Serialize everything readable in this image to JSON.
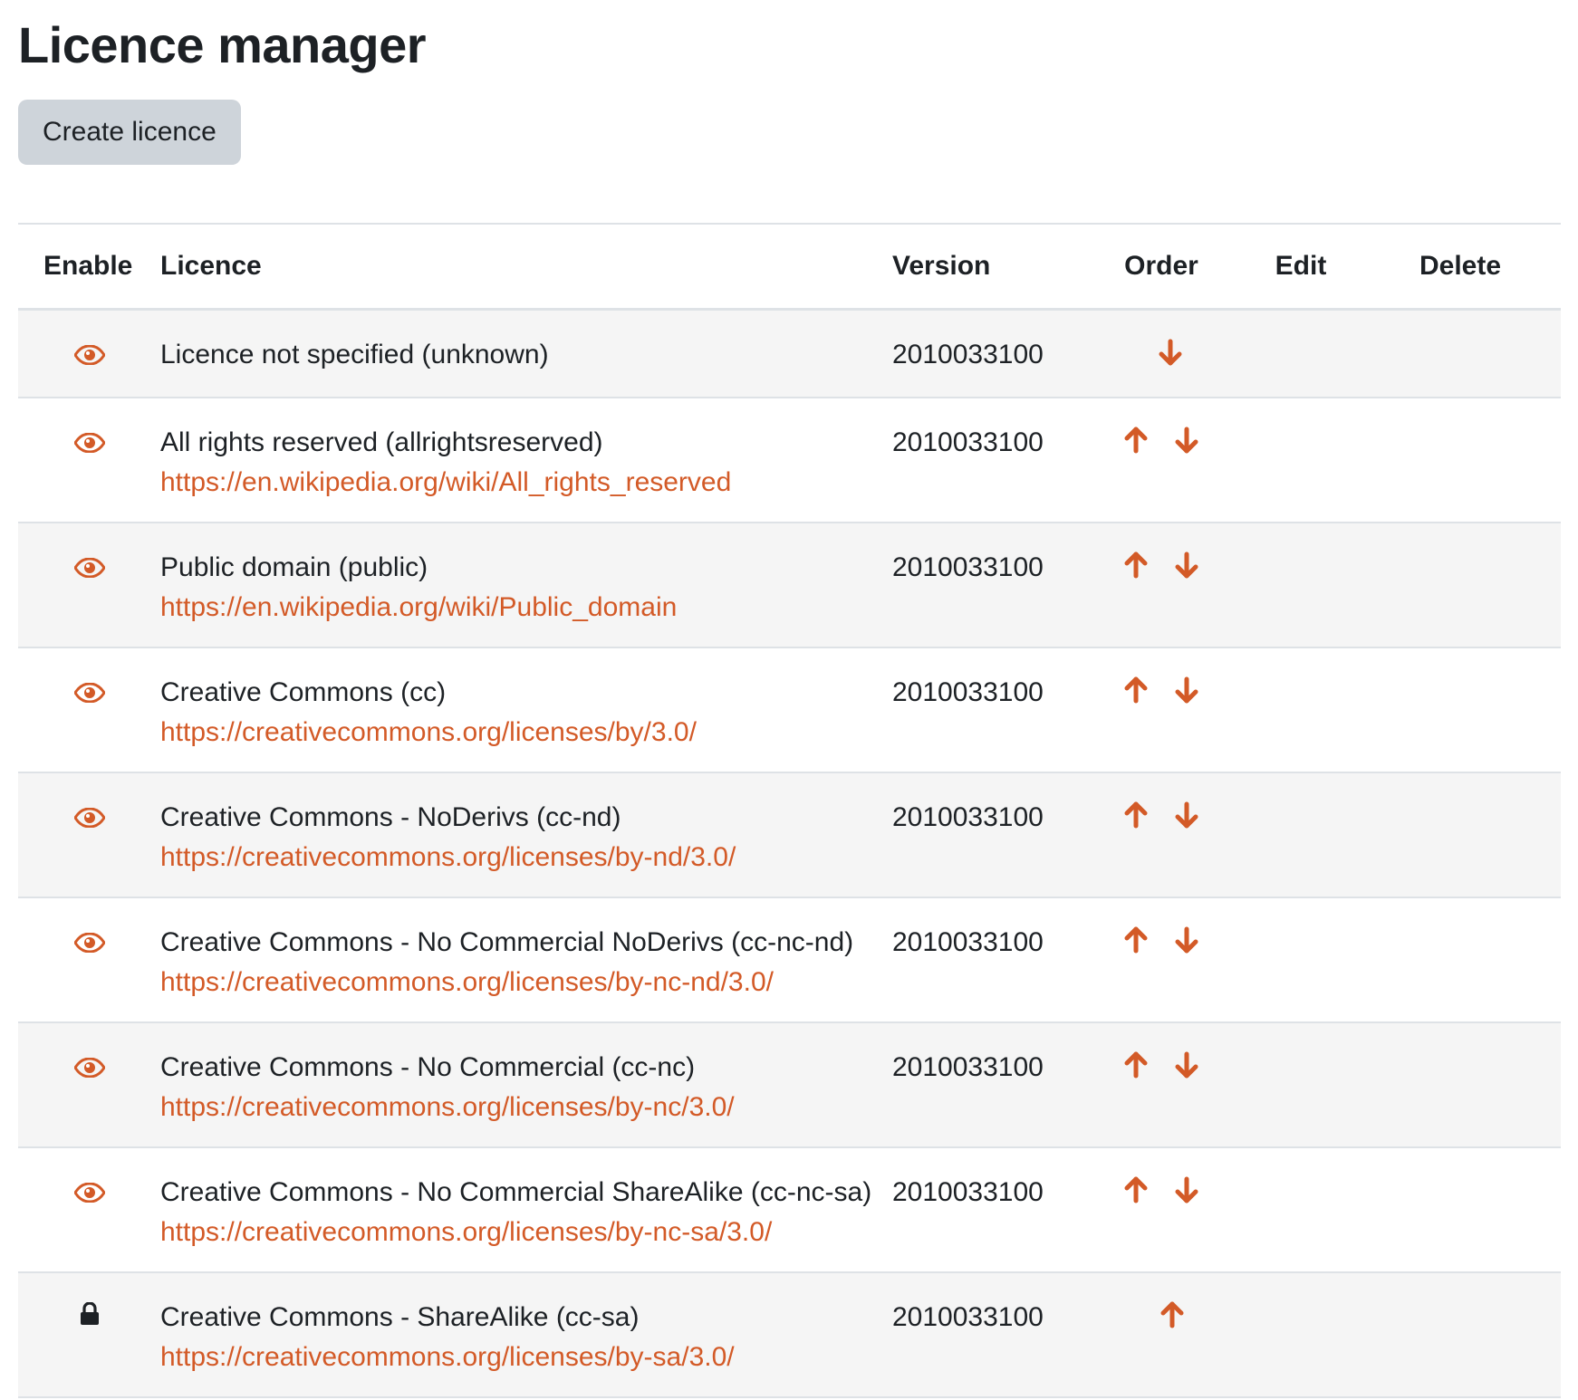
{
  "page": {
    "title": "Licence manager",
    "create_button": "Create licence"
  },
  "table": {
    "headers": {
      "enable": "Enable",
      "licence": "Licence",
      "version": "Version",
      "order": "Order",
      "edit": "Edit",
      "delete": "Delete"
    },
    "rows": [
      {
        "name": "Licence not specified (unknown)",
        "link": "",
        "version": "2010033100",
        "enable_icon": "eye-icon",
        "up": false,
        "down": true
      },
      {
        "name": "All rights reserved (allrightsreserved)",
        "link": "https://en.wikipedia.org/wiki/All_rights_reserved",
        "version": "2010033100",
        "enable_icon": "eye-icon",
        "up": true,
        "down": true
      },
      {
        "name": "Public domain (public)",
        "link": "https://en.wikipedia.org/wiki/Public_domain",
        "version": "2010033100",
        "enable_icon": "eye-icon",
        "up": true,
        "down": true
      },
      {
        "name": "Creative Commons (cc)",
        "link": "https://creativecommons.org/licenses/by/3.0/",
        "version": "2010033100",
        "enable_icon": "eye-icon",
        "up": true,
        "down": true
      },
      {
        "name": "Creative Commons - NoDerivs (cc-nd)",
        "link": "https://creativecommons.org/licenses/by-nd/3.0/",
        "version": "2010033100",
        "enable_icon": "eye-icon",
        "up": true,
        "down": true
      },
      {
        "name": "Creative Commons - No Commercial NoDerivs (cc-nc-nd)",
        "link": "https://creativecommons.org/licenses/by-nc-nd/3.0/",
        "version": "2010033100",
        "enable_icon": "eye-icon",
        "up": true,
        "down": true
      },
      {
        "name": "Creative Commons - No Commercial (cc-nc)",
        "link": "https://creativecommons.org/licenses/by-nc/3.0/",
        "version": "2010033100",
        "enable_icon": "eye-icon",
        "up": true,
        "down": true
      },
      {
        "name": "Creative Commons - No Commercial ShareAlike (cc-nc-sa)",
        "link": "https://creativecommons.org/licenses/by-nc-sa/3.0/",
        "version": "2010033100",
        "enable_icon": "eye-icon",
        "up": true,
        "down": true
      },
      {
        "name": "Creative Commons - ShareAlike (cc-sa)",
        "link": "https://creativecommons.org/licenses/by-sa/3.0/",
        "version": "2010033100",
        "enable_icon": "lock-icon",
        "up": true,
        "down": false
      }
    ]
  },
  "colors": {
    "accent": "#d35a27",
    "button_bg": "#ced4da",
    "text": "#1d2125",
    "stripe": "#f5f5f5",
    "border": "#dee2e6"
  }
}
